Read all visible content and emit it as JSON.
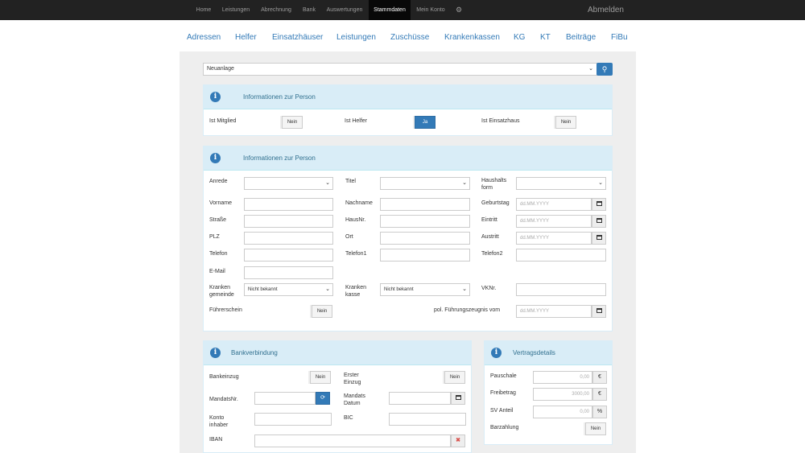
{
  "nav": {
    "items": [
      "Home",
      "Leistungen",
      "Abrechnung",
      "Bank",
      "Auswertungen",
      "Stammdaten",
      "Mein Konto"
    ],
    "active": "Stammdaten",
    "gear_icon": "gear-icon",
    "logout_label": "Abmelden"
  },
  "subtabs": [
    "Adressen",
    "Helfer",
    "Einsatzhäuser",
    "Leistungen",
    "Zuschüsse",
    "Krankenkassen",
    "KG",
    "KT",
    "Beiträge",
    "FiBu"
  ],
  "person_select": {
    "value": "Neuanlage"
  },
  "panel_info1": {
    "title": "Informationen zur Person",
    "ist_mitglied_label": "Ist Mitglied",
    "ist_mitglied_value": "Nein",
    "ist_helfer_label": "Ist Helfer",
    "ist_helfer_value": "Ja",
    "ist_einsatzhaus_label": "Ist Einsatzhaus",
    "ist_einsatzhaus_value": "Nein"
  },
  "panel_info2": {
    "title": "Informationen zur Person",
    "anrede_label": "Anrede",
    "titel_label": "Titel",
    "haushaltsform_label": "Haushalts form",
    "vorname_label": "Vorname",
    "nachname_label": "Nachname",
    "geburtstag_label": "Geburtstag",
    "strasse_label": "Straße",
    "hausnr_label": "HausNr.",
    "eintritt_label": "Eintritt",
    "plz_label": "PLZ",
    "ort_label": "Ort",
    "austritt_label": "Austritt",
    "telefon_label": "Telefon",
    "telefon1_label": "Telefon1",
    "telefon2_label": "Telefon2",
    "email_label": "E-Mail",
    "kg_label": "Kranken gemeinde",
    "kg_value": "Nicht bekannt",
    "kk_label": "Kranken kasse",
    "kk_value": "Nicht bekannt",
    "vknr_label": "VKNr.",
    "fuehrerschein_label": "Führerschein",
    "fuehrerschein_value": "Nein",
    "fuehrungszeugnis_label": "pol. Führungszeugnis vom",
    "date_placeholder": "dd.MM.YYYY"
  },
  "panel_bank": {
    "title": "Bankverbindung",
    "bankeinzug_label": "Bankeinzug",
    "bankeinzug_value": "Nein",
    "erster_einzug_label": "Erster Einzug",
    "erster_einzug_value": "Nein",
    "mandatsnr_label": "MandatsNr.",
    "mandats_datum_label": "Mandats Datum",
    "konto_inhaber_label": "Konto inhaber",
    "bic_label": "BIC",
    "iban_label": "IBAN"
  },
  "panel_vertrag": {
    "title": "Vertragsdetails",
    "pauschale_label": "Pauschale",
    "pauschale_value": "0,00",
    "pauschale_unit": "€",
    "freibetrag_label": "Freibetrag",
    "freibetrag_value": "3000,00",
    "freibetrag_unit": "€",
    "sv_anteil_label": "SV Anteil",
    "sv_anteil_value": "0,00",
    "sv_anteil_unit": "%",
    "barzahlung_label": "Barzahlung",
    "barzahlung_value": "Nein"
  }
}
